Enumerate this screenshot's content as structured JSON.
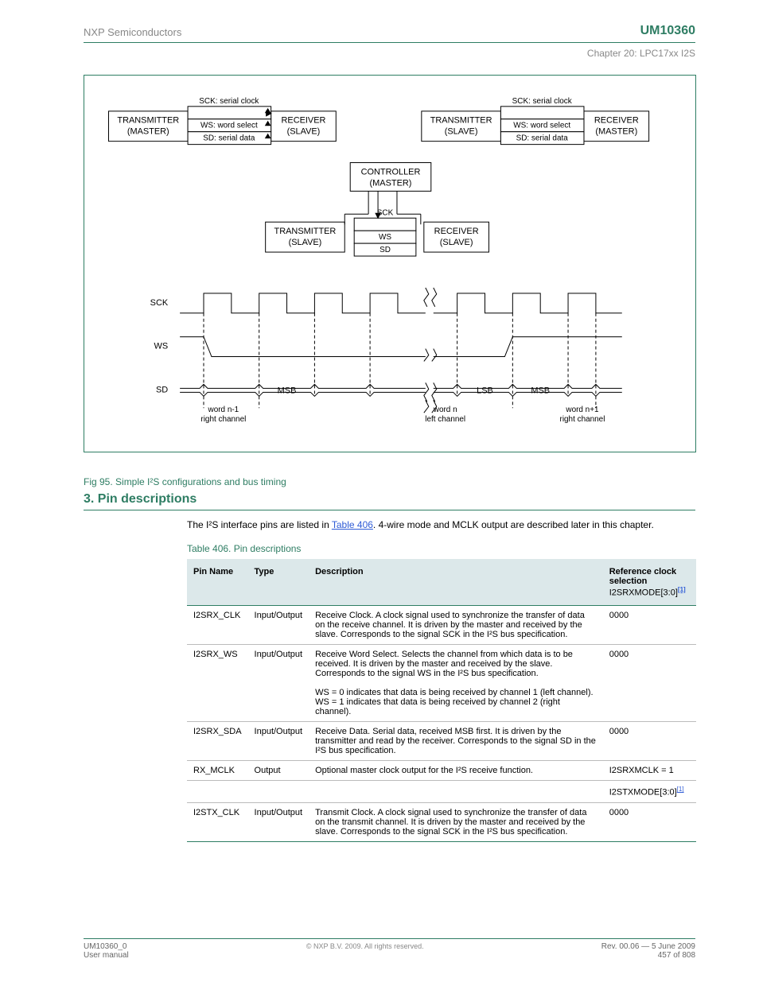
{
  "header": {
    "left": "UM10360",
    "right": "NXP Semiconductors"
  },
  "subheader": "Chapter 20: LPC17xx I2S",
  "figure": {
    "caption": "Fig 95. Simple I²S configurations and bus timing",
    "blocks": {
      "txm": [
        "TRANSMITTER",
        "(MASTER)"
      ],
      "rxs": [
        "RECEIVER",
        "(SLAVE)"
      ],
      "txs": [
        "TRANSMITTER",
        "(SLAVE)"
      ],
      "rxm": [
        "RECEIVER",
        "(MASTER)"
      ],
      "ctrl": [
        "CONTROLLER",
        "(MASTER)"
      ],
      "sck_lbl": "SCK: serial clock",
      "ws_lbl": "WS: word select",
      "sd_lbl": "SD: serial data",
      "sck": "SCK",
      "ws": "WS",
      "sd": "SD"
    },
    "timing": {
      "msb": "MSB",
      "lsb": "LSB",
      "w_nm1": [
        "word n-1",
        "right channel"
      ],
      "w_n": [
        "word n",
        "left channel"
      ],
      "w_np1": [
        "word n+1",
        "right channel"
      ]
    }
  },
  "section3": {
    "title": "3.   Pin descriptions",
    "para1_pre": "The I²S interface pins are listed in ",
    "para1_link": "Table 406",
    "para1_post": ". 4-wire mode and MCLK output are described later in this chapter."
  },
  "table406": {
    "caption": "Table 406. Pin descriptions",
    "cols": [
      "Pin Name",
      "Type",
      "Description",
      "Reference clock selection"
    ],
    "subnote": [
      "I2SRXMODE",
      "[3:0]"
    ],
    "rows": [
      [
        "I2SRX_CLK",
        "Input/Output",
        "Receive Clock. A clock signal used to synchronize the transfer of data on the receive channel. It is driven by the master and received by the slave. Corresponds to the signal SCK in the I²S bus specification.",
        "0000"
      ],
      [
        "I2SRX_WS",
        "Input/Output",
        "Receive Word Select. Selects the channel from which data is to be received. It is driven by the master and received by the slave. Corresponds to the signal WS in the I²S bus specification.\n\nWS = 0 indicates that data is being received by channel 1 (left channel).\nWS = 1 indicates that data is being received by channel 2 (right channel).",
        "0000"
      ],
      [
        "I2SRX_SDA",
        "Input/Output",
        "Receive Data. Serial data, received MSB first. It is driven by the transmitter and read by the receiver. Corresponds to the signal SD in the I²S bus specification.",
        "0000"
      ],
      [
        "RX_MCLK",
        "Output",
        "Optional master clock output for the I²S receive function.",
        "I2SRXMCLK = 1"
      ],
      [
        "",
        "",
        "",
        "I2STXMODE[3:0][1]"
      ],
      [
        "I2STX_CLK",
        "Input/Output",
        "Transmit Clock. A clock signal used to synchronize the transfer of data on the transmit channel. It is driven by the master and received by the slave. Corresponds to the signal SCK in the I²S bus specification.",
        "0000"
      ]
    ]
  },
  "footer": {
    "left_line1": "UM10360_0",
    "left_line2": "User manual",
    "center": "© NXP B.V. 2009. All rights reserved.",
    "right_line1": "Rev. 00.06 — 5 June 2009",
    "right_line2": "457 of 808"
  }
}
